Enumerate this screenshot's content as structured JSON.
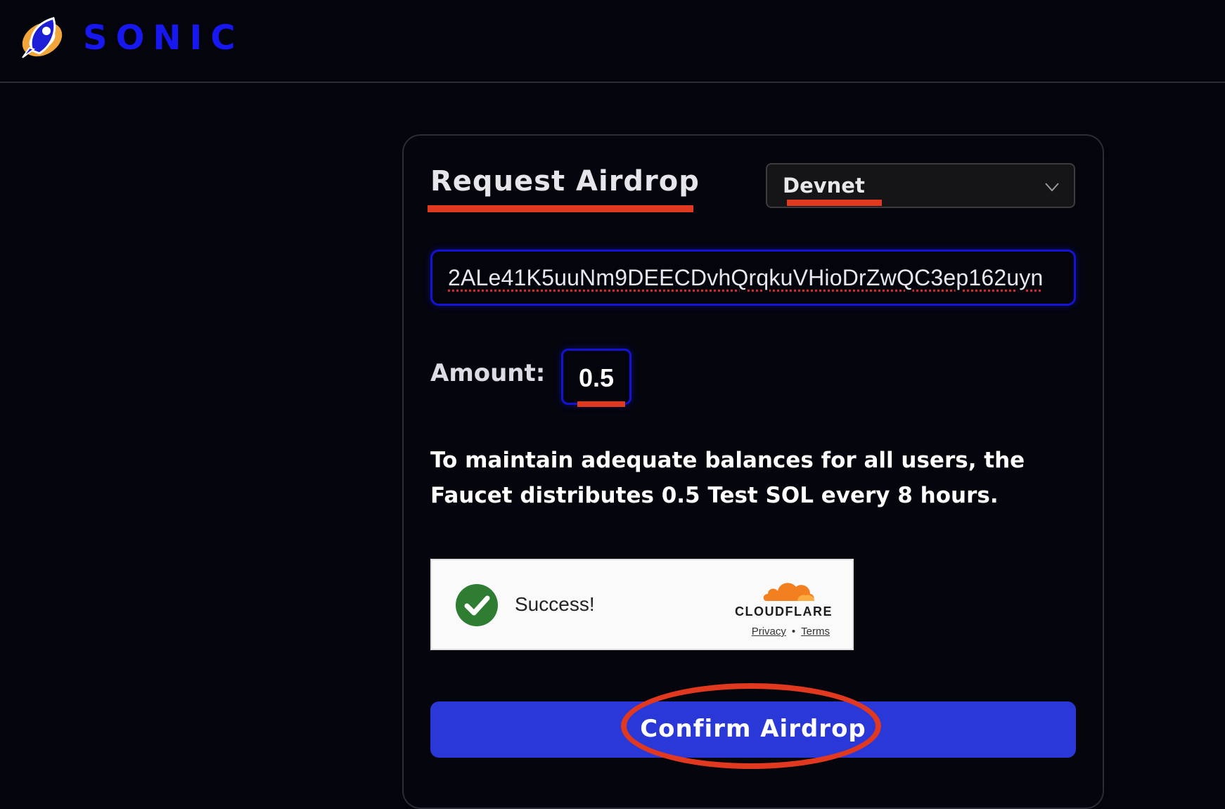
{
  "header": {
    "brand": "SONIC",
    "logo_icon": "rocket-planet-logo"
  },
  "form": {
    "title": "Request Airdrop",
    "network": {
      "selected": "Devnet",
      "icon": "chevron-down-icon"
    },
    "address_value": "2ALe41K5uuNm9DEECDvhQrqkuVHioDrZwQC3ep162uyn",
    "amount_label": "Amount:",
    "amount_value": "0.5",
    "notice": "To maintain adequate balances for all users, the Faucet distributes 0.5 Test SOL every 8 hours.",
    "confirm_label": "Confirm Airdrop"
  },
  "captcha": {
    "status": "Success!",
    "brand": "CLOUDFLARE",
    "privacy_link": "Privacy",
    "separator": "•",
    "terms_link": "Terms",
    "status_icon": "check-icon",
    "status_color": "#2e7d32"
  },
  "colors": {
    "background": "#03040c",
    "brand_blue": "#1717f0",
    "button_blue": "#2b38d8",
    "annotation_red": "#e0391f",
    "cloudflare_orange": "#f38020"
  }
}
